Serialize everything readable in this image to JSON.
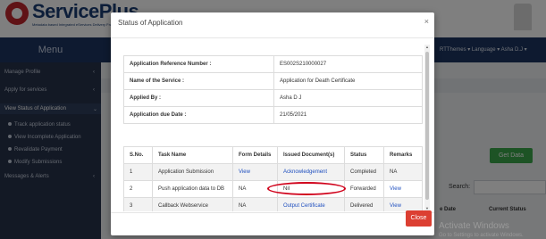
{
  "site": {
    "logo_text": "ServicePlus",
    "logo_subtitle": "Metadata based Integrated eServices Delivery Framework",
    "menu_title": "Menu",
    "top_right": "RTThemes ▾ Language ▾ Asha D.J ▾"
  },
  "sidebar": {
    "items": [
      {
        "label": "Manage Profile"
      },
      {
        "label": "Apply for services"
      },
      {
        "label": "View Status of Application"
      },
      {
        "label": "Track application status"
      },
      {
        "label": "View Incomplete Application"
      },
      {
        "label": "Revalidate Payment"
      },
      {
        "label": "Modify Submissions"
      },
      {
        "label": "Messages & Alerts"
      }
    ]
  },
  "background": {
    "get_data_label": "Get Data",
    "search_label": "Search:",
    "col_date": "e Date",
    "col_status": "Current Status",
    "activate_title": "Activate Windows",
    "activate_sub": "Go to Settings to activate Windows."
  },
  "modal": {
    "title": "Status of Application",
    "close_x": "×",
    "close_button": "Close",
    "info": {
      "ref_label": "Application Reference Number :",
      "ref_value": "ES002S210000027",
      "service_label": "Name of the Service :",
      "service_value": "Application for Death Certificate",
      "applied_by_label": "Applied By :",
      "applied_by_value": "Asha D J",
      "due_date_label": "Application due Date :",
      "due_date_value": "21/05/2021"
    },
    "table": {
      "headers": [
        "S.No.",
        "Task Name",
        "Form Details",
        "Issued Document(s)",
        "Status",
        "Remarks"
      ],
      "rows": [
        {
          "sno": "1",
          "task": "Application Submission",
          "form": "View",
          "doc": "Acknowledgement",
          "status": "Completed",
          "remarks": "NA"
        },
        {
          "sno": "2",
          "task": "Push application data to DB",
          "form": "NA",
          "doc": "Nil",
          "status": "Forwarded",
          "remarks": "View"
        },
        {
          "sno": "3",
          "task": "Callback Webservice",
          "form": "NA",
          "doc": "Output Certificate",
          "status": "Delivered",
          "remarks": "View"
        }
      ]
    }
  },
  "colors": {
    "header_bg": "#1c3560",
    "sidebar_bg": "#26324a",
    "close_btn": "#dc3f32",
    "link": "#1f4fbf",
    "highlight": "#d0021b",
    "get_data_btn": "#3aa64a"
  }
}
